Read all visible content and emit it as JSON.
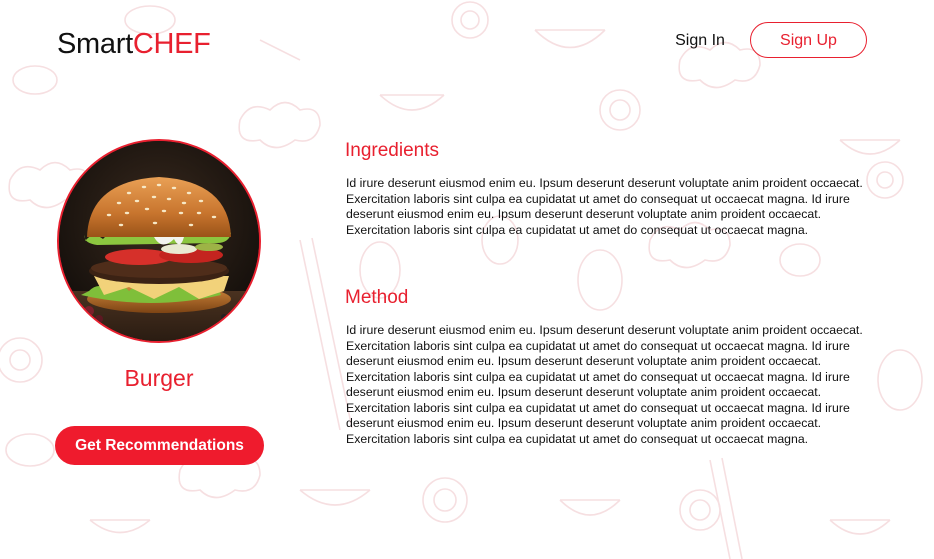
{
  "header": {
    "logo_main": "Smart",
    "logo_accent": "CHEF",
    "sign_in_label": "Sign In",
    "sign_up_label": "Sign Up"
  },
  "dish": {
    "name": "Burger",
    "image_icon": "burger-photo",
    "recommend_label": "Get Recommendations"
  },
  "sections": {
    "ingredients": {
      "title": "Ingredients",
      "body": "Id irure deserunt eiusmod enim eu. Ipsum deserunt deserunt voluptate anim proident occaecat. Exercitation laboris sint culpa ea cupidatat ut amet do consequat ut occaecat magna. Id irure deserunt eiusmod enim eu. Ipsum deserunt deserunt voluptate anim proident occaecat. Exercitation laboris sint culpa ea cupidatat ut amet do consequat ut occaecat magna."
    },
    "method": {
      "title": "Method",
      "body": "Id irure deserunt eiusmod enim eu. Ipsum deserunt deserunt voluptate anim proident occaecat. Exercitation laboris sint culpa ea cupidatat ut amet do consequat ut occaecat magna. Id irure deserunt eiusmod enim eu. Ipsum deserunt deserunt voluptate anim proident occaecat. Exercitation laboris sint culpa ea cupidatat ut amet do consequat ut occaecat magna. Id irure deserunt eiusmod enim eu. Ipsum deserunt deserunt voluptate anim proident occaecat. Exercitation laboris sint culpa ea cupidatat ut amet do consequat ut occaecat magna. Id irure deserunt eiusmod enim eu. Ipsum deserunt deserunt voluptate anim proident occaecat. Exercitation laboris sint culpa ea cupidatat ut amet do consequat ut occaecat magna."
    }
  },
  "colors": {
    "accent": "#e8202f",
    "button": "#ef1b2d",
    "background_pattern": "#fbe9ea"
  }
}
